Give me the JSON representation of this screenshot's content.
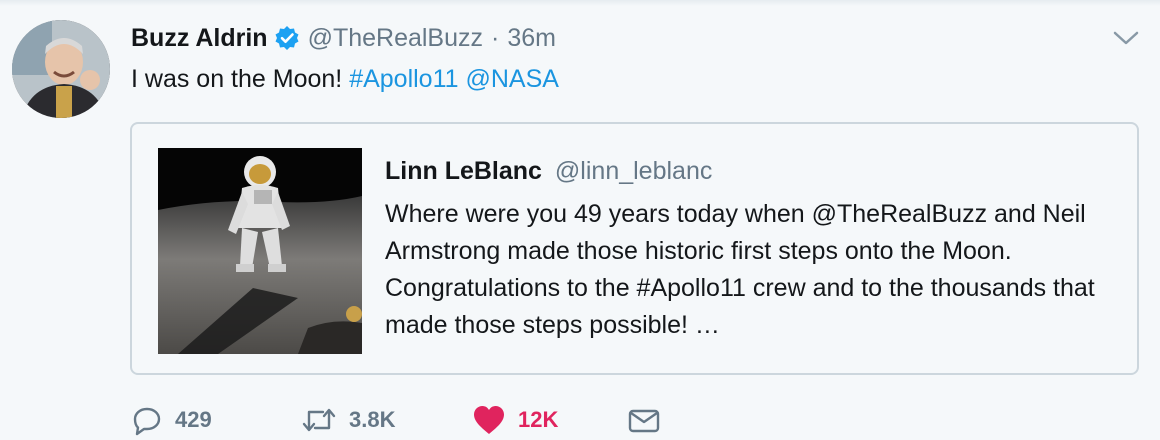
{
  "colors": {
    "link": "#1b95e0",
    "secondary_text": "#657786",
    "like_active": "#e0245e",
    "verified": "#1da1f2",
    "border": "#ccd6dd"
  },
  "tweet": {
    "author_name": "Buzz Aldrin",
    "author_handle": "@TheRealBuzz",
    "separator": "·",
    "timestamp": "36m",
    "text_plain": "I was on the Moon!",
    "hashtag": "#Apollo11",
    "mention": "@NASA",
    "icons": {
      "avatar": "avatar-photo",
      "verified": "verified-badge-icon",
      "menu": "chevron-down-icon"
    }
  },
  "quoted_tweet": {
    "author_name": "Linn LeBlanc",
    "author_handle": "@linn_leblanc",
    "text": "Where were you 49 years today when @TheRealBuzz  and Neil Armstrong made those historic first steps onto the Moon. Congratulations to the #Apollo11 crew and to the thousands that made those steps possible! …",
    "media": "astronaut-on-moon-photo"
  },
  "actions": {
    "reply_count": "429",
    "retweet_count": "3.8K",
    "like_count": "12K",
    "icons": [
      "reply-icon",
      "retweet-icon",
      "heart-icon",
      "message-icon"
    ]
  }
}
